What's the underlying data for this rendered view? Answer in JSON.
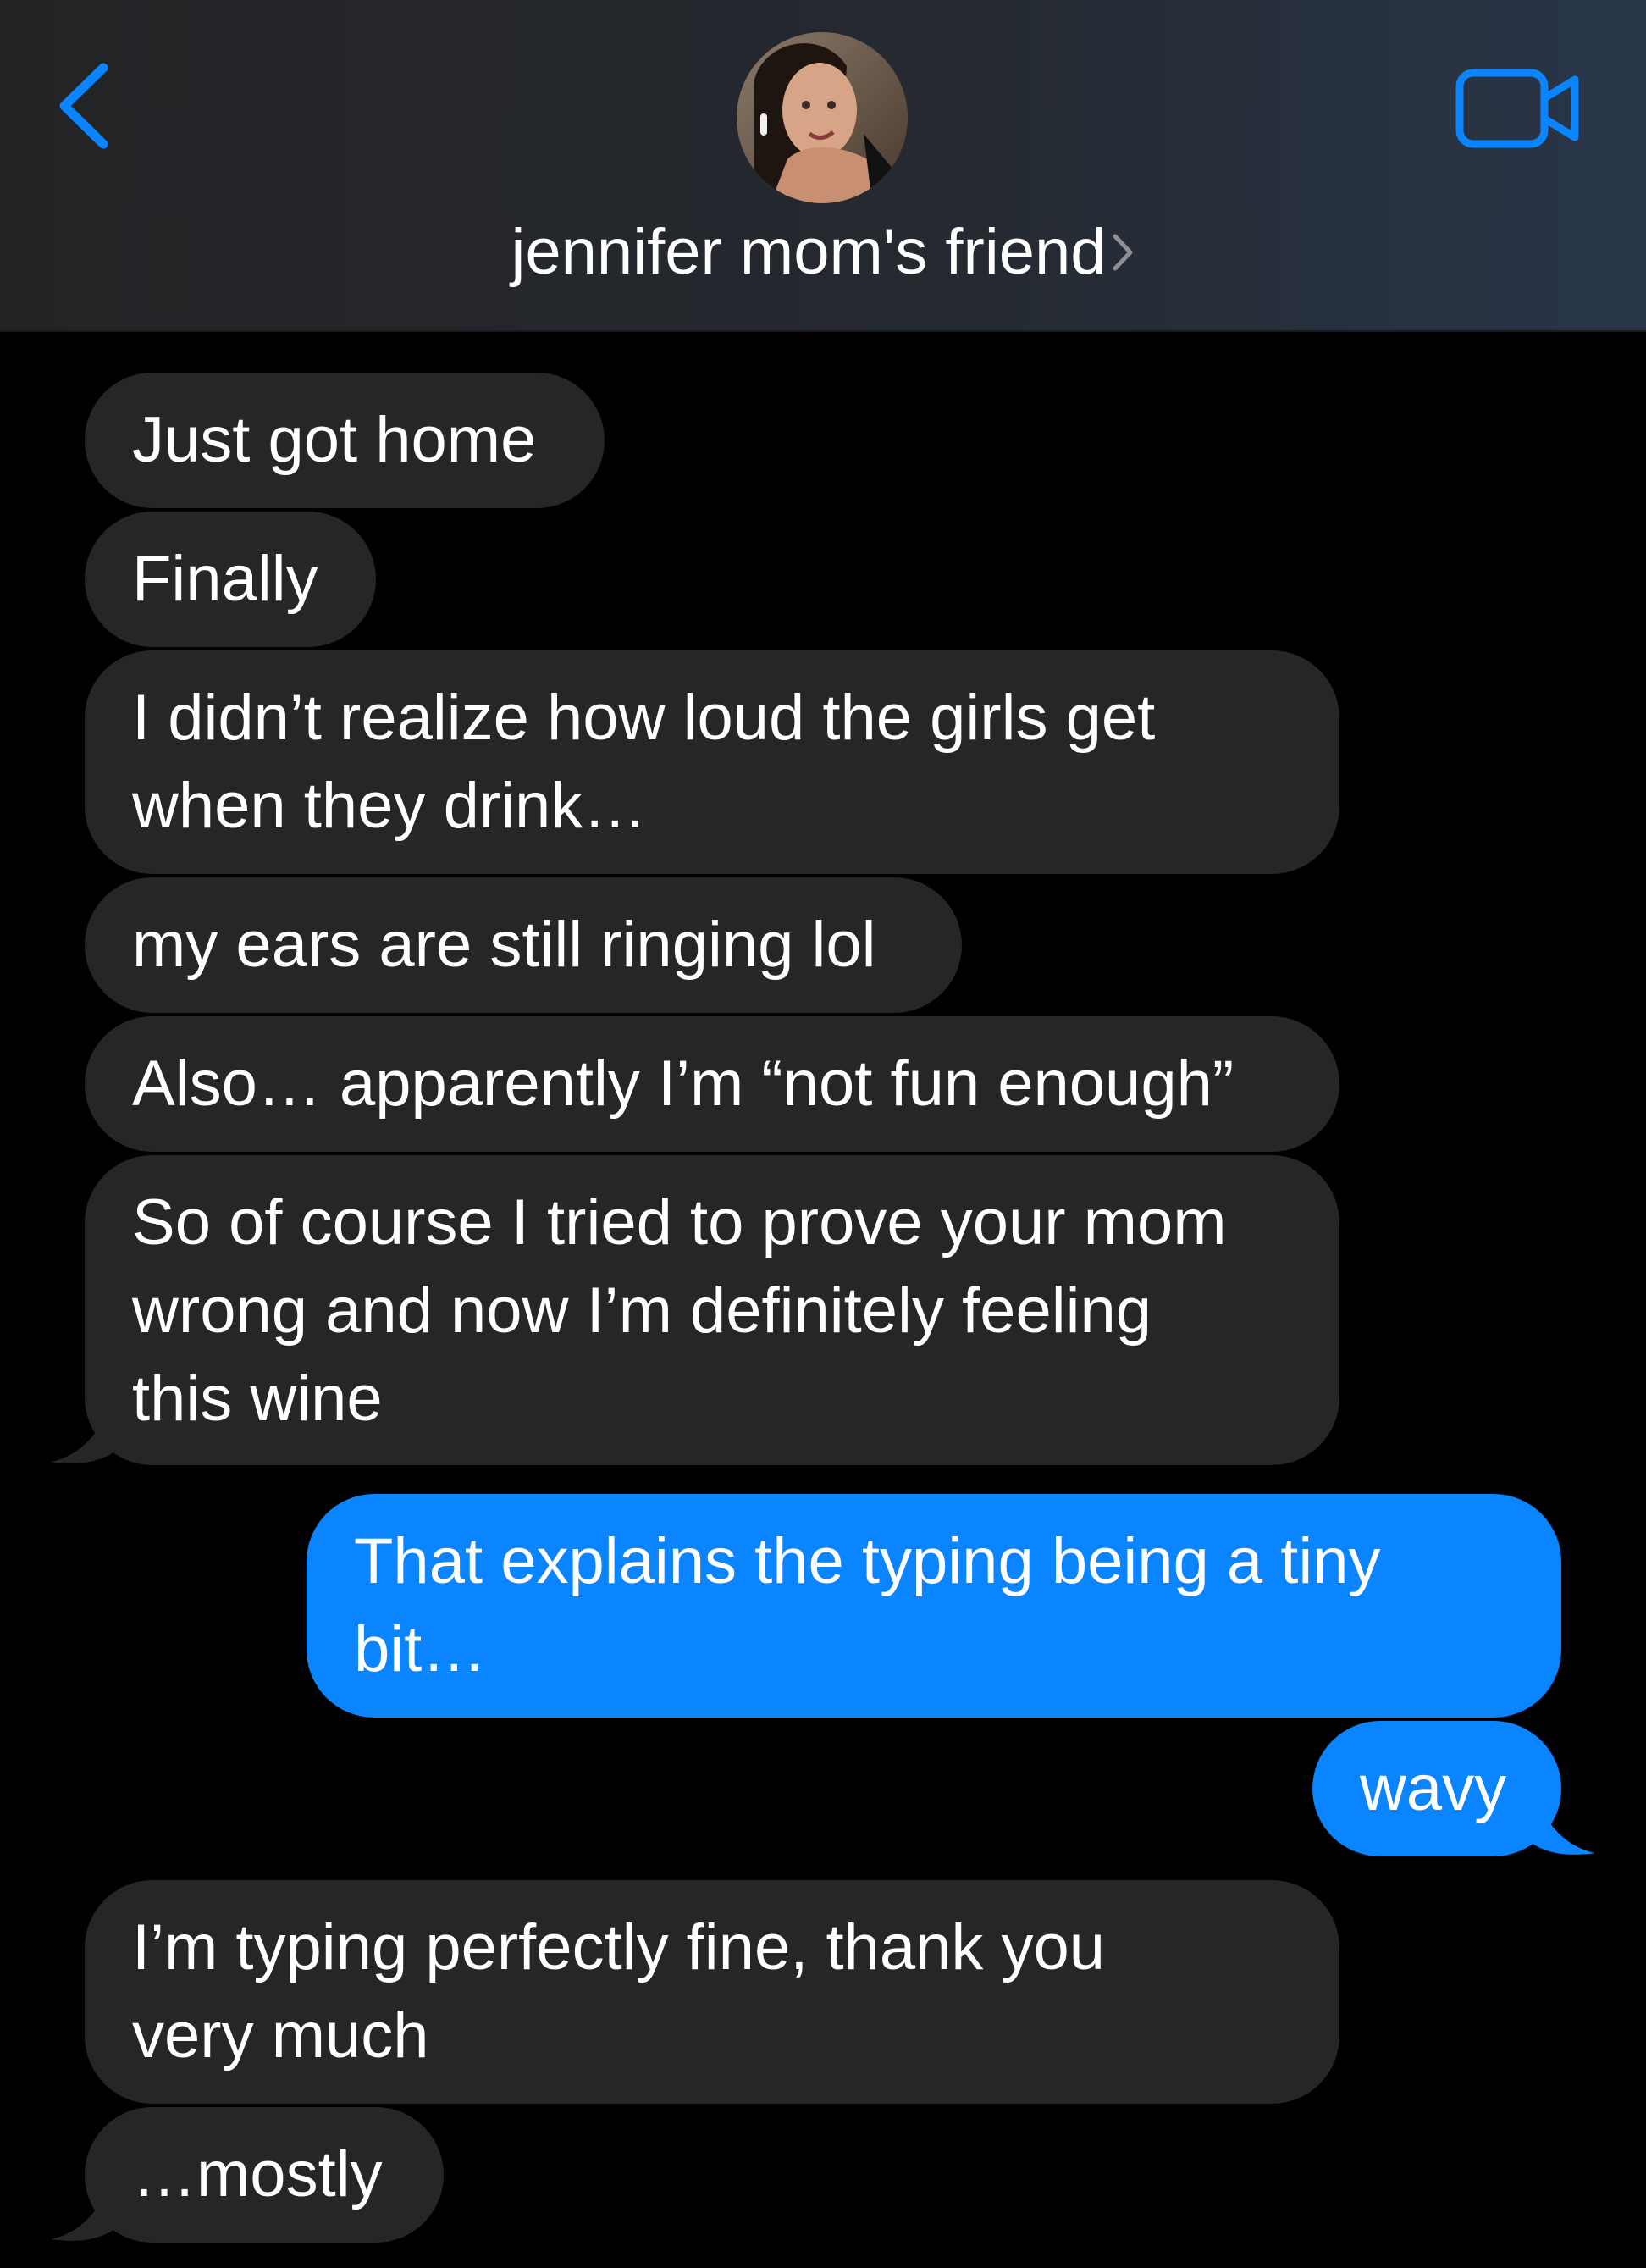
{
  "header": {
    "contact_name": "jennifer mom's friend",
    "back_icon": "chevron-left-icon",
    "video_icon": "video-camera-icon",
    "accent_color": "#0a84ff"
  },
  "messages": [
    {
      "direction": "received",
      "lines": [
        "Just got home"
      ]
    },
    {
      "direction": "received",
      "lines": [
        "Finally"
      ]
    },
    {
      "direction": "received",
      "lines": [
        "I didn’t realize how loud the girls get",
        "when they drink…"
      ]
    },
    {
      "direction": "received",
      "lines": [
        "my ears are still ringing lol"
      ]
    },
    {
      "direction": "received",
      "lines": [
        "Also… apparently I’m “not fun enough”"
      ]
    },
    {
      "direction": "received",
      "lines": [
        "So of course I tried to prove your mom",
        "wrong and now I’m definitely feeling",
        "this wine"
      ]
    },
    {
      "direction": "sent",
      "lines": [
        "That explains the typing being a tiny",
        "bit…"
      ]
    },
    {
      "direction": "sent",
      "lines": [
        "wavy"
      ]
    },
    {
      "direction": "received",
      "lines": [
        "I’m typing perfectly fine, thank you",
        "very much"
      ]
    },
    {
      "direction": "received",
      "lines": [
        "…mostly"
      ]
    }
  ],
  "colors": {
    "received_bubble": "#262629",
    "sent_bubble": "#0a84ff",
    "background": "#000000"
  }
}
